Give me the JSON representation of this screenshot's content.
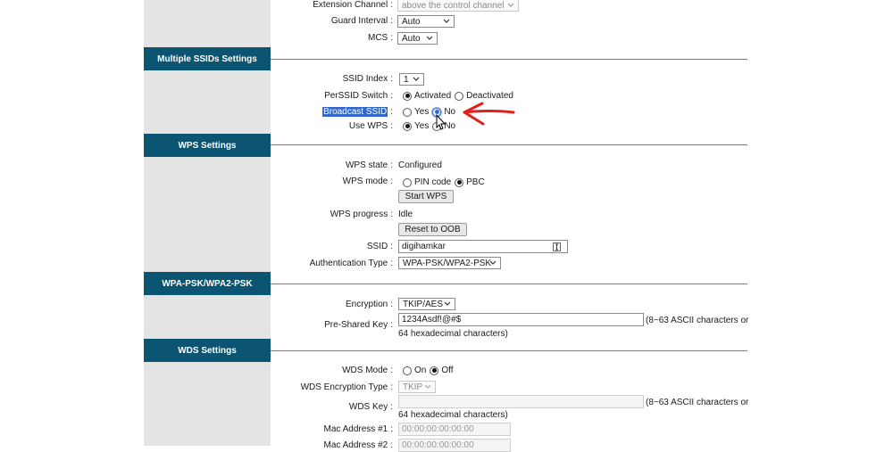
{
  "wireless": {
    "extension_channel": {
      "label": "Extension Channel",
      "value": "above the control channel"
    },
    "guard_interval": {
      "label": "Guard Interval",
      "value": "Auto"
    },
    "mcs": {
      "label": "MCS",
      "value": "Auto"
    }
  },
  "ssids": {
    "header": "Multiple SSIDs Settings",
    "ssid_index": {
      "label": "SSID Index",
      "value": "1"
    },
    "perssid_switch": {
      "label": "PerSSID Switch",
      "options": [
        "Activated",
        "Deactivated"
      ],
      "selected": "Activated"
    },
    "broadcast_ssid": {
      "label": "Broadcast SSID",
      "options": [
        "Yes",
        "No"
      ],
      "selected": "No"
    },
    "use_wps": {
      "label": "Use WPS",
      "options": [
        "Yes",
        "No"
      ],
      "selected": "Yes"
    }
  },
  "wps": {
    "header": "WPS Settings",
    "state": {
      "label": "WPS state",
      "value": "Configured"
    },
    "mode": {
      "label": "WPS mode",
      "options": [
        "PIN code",
        "PBC"
      ],
      "selected": "PBC"
    },
    "start_button": "Start WPS",
    "progress": {
      "label": "WPS progress",
      "value": "Idle"
    },
    "reset_button": "Reset to OOB",
    "ssid": {
      "label": "SSID",
      "value": "digihamkar"
    },
    "auth_type": {
      "label": "Authentication Type",
      "value": "WPA-PSK/WPA2-PSK"
    }
  },
  "wpa": {
    "header": "WPA-PSK/WPA2-PSK",
    "encryption": {
      "label": "Encryption",
      "value": "TKIP/AES"
    },
    "psk": {
      "label": "Pre-Shared Key",
      "value": "1234Asdf!@#$",
      "hint_line1": "(8~63 ASCII characters or",
      "hint_line2": "64 hexadecimal characters)"
    }
  },
  "wds": {
    "header": "WDS Settings",
    "mode": {
      "label": "WDS Mode",
      "options": [
        "On",
        "Off"
      ],
      "selected": "Off"
    },
    "encryption_type": {
      "label": "WDS Encryption Type",
      "value": "TKIP"
    },
    "key": {
      "label": "WDS Key",
      "value": "",
      "hint_line1": "(8~63 ASCII characters or",
      "hint_line2": "64 hexadecimal characters)"
    },
    "mac1": {
      "label": "Mac Address #1",
      "value": "00:00:00:00:00:00"
    },
    "mac2": {
      "label": "Mac Address #2",
      "value": "00:00:00:00:00:00"
    }
  },
  "annotation": {
    "color": "#e0201b"
  }
}
